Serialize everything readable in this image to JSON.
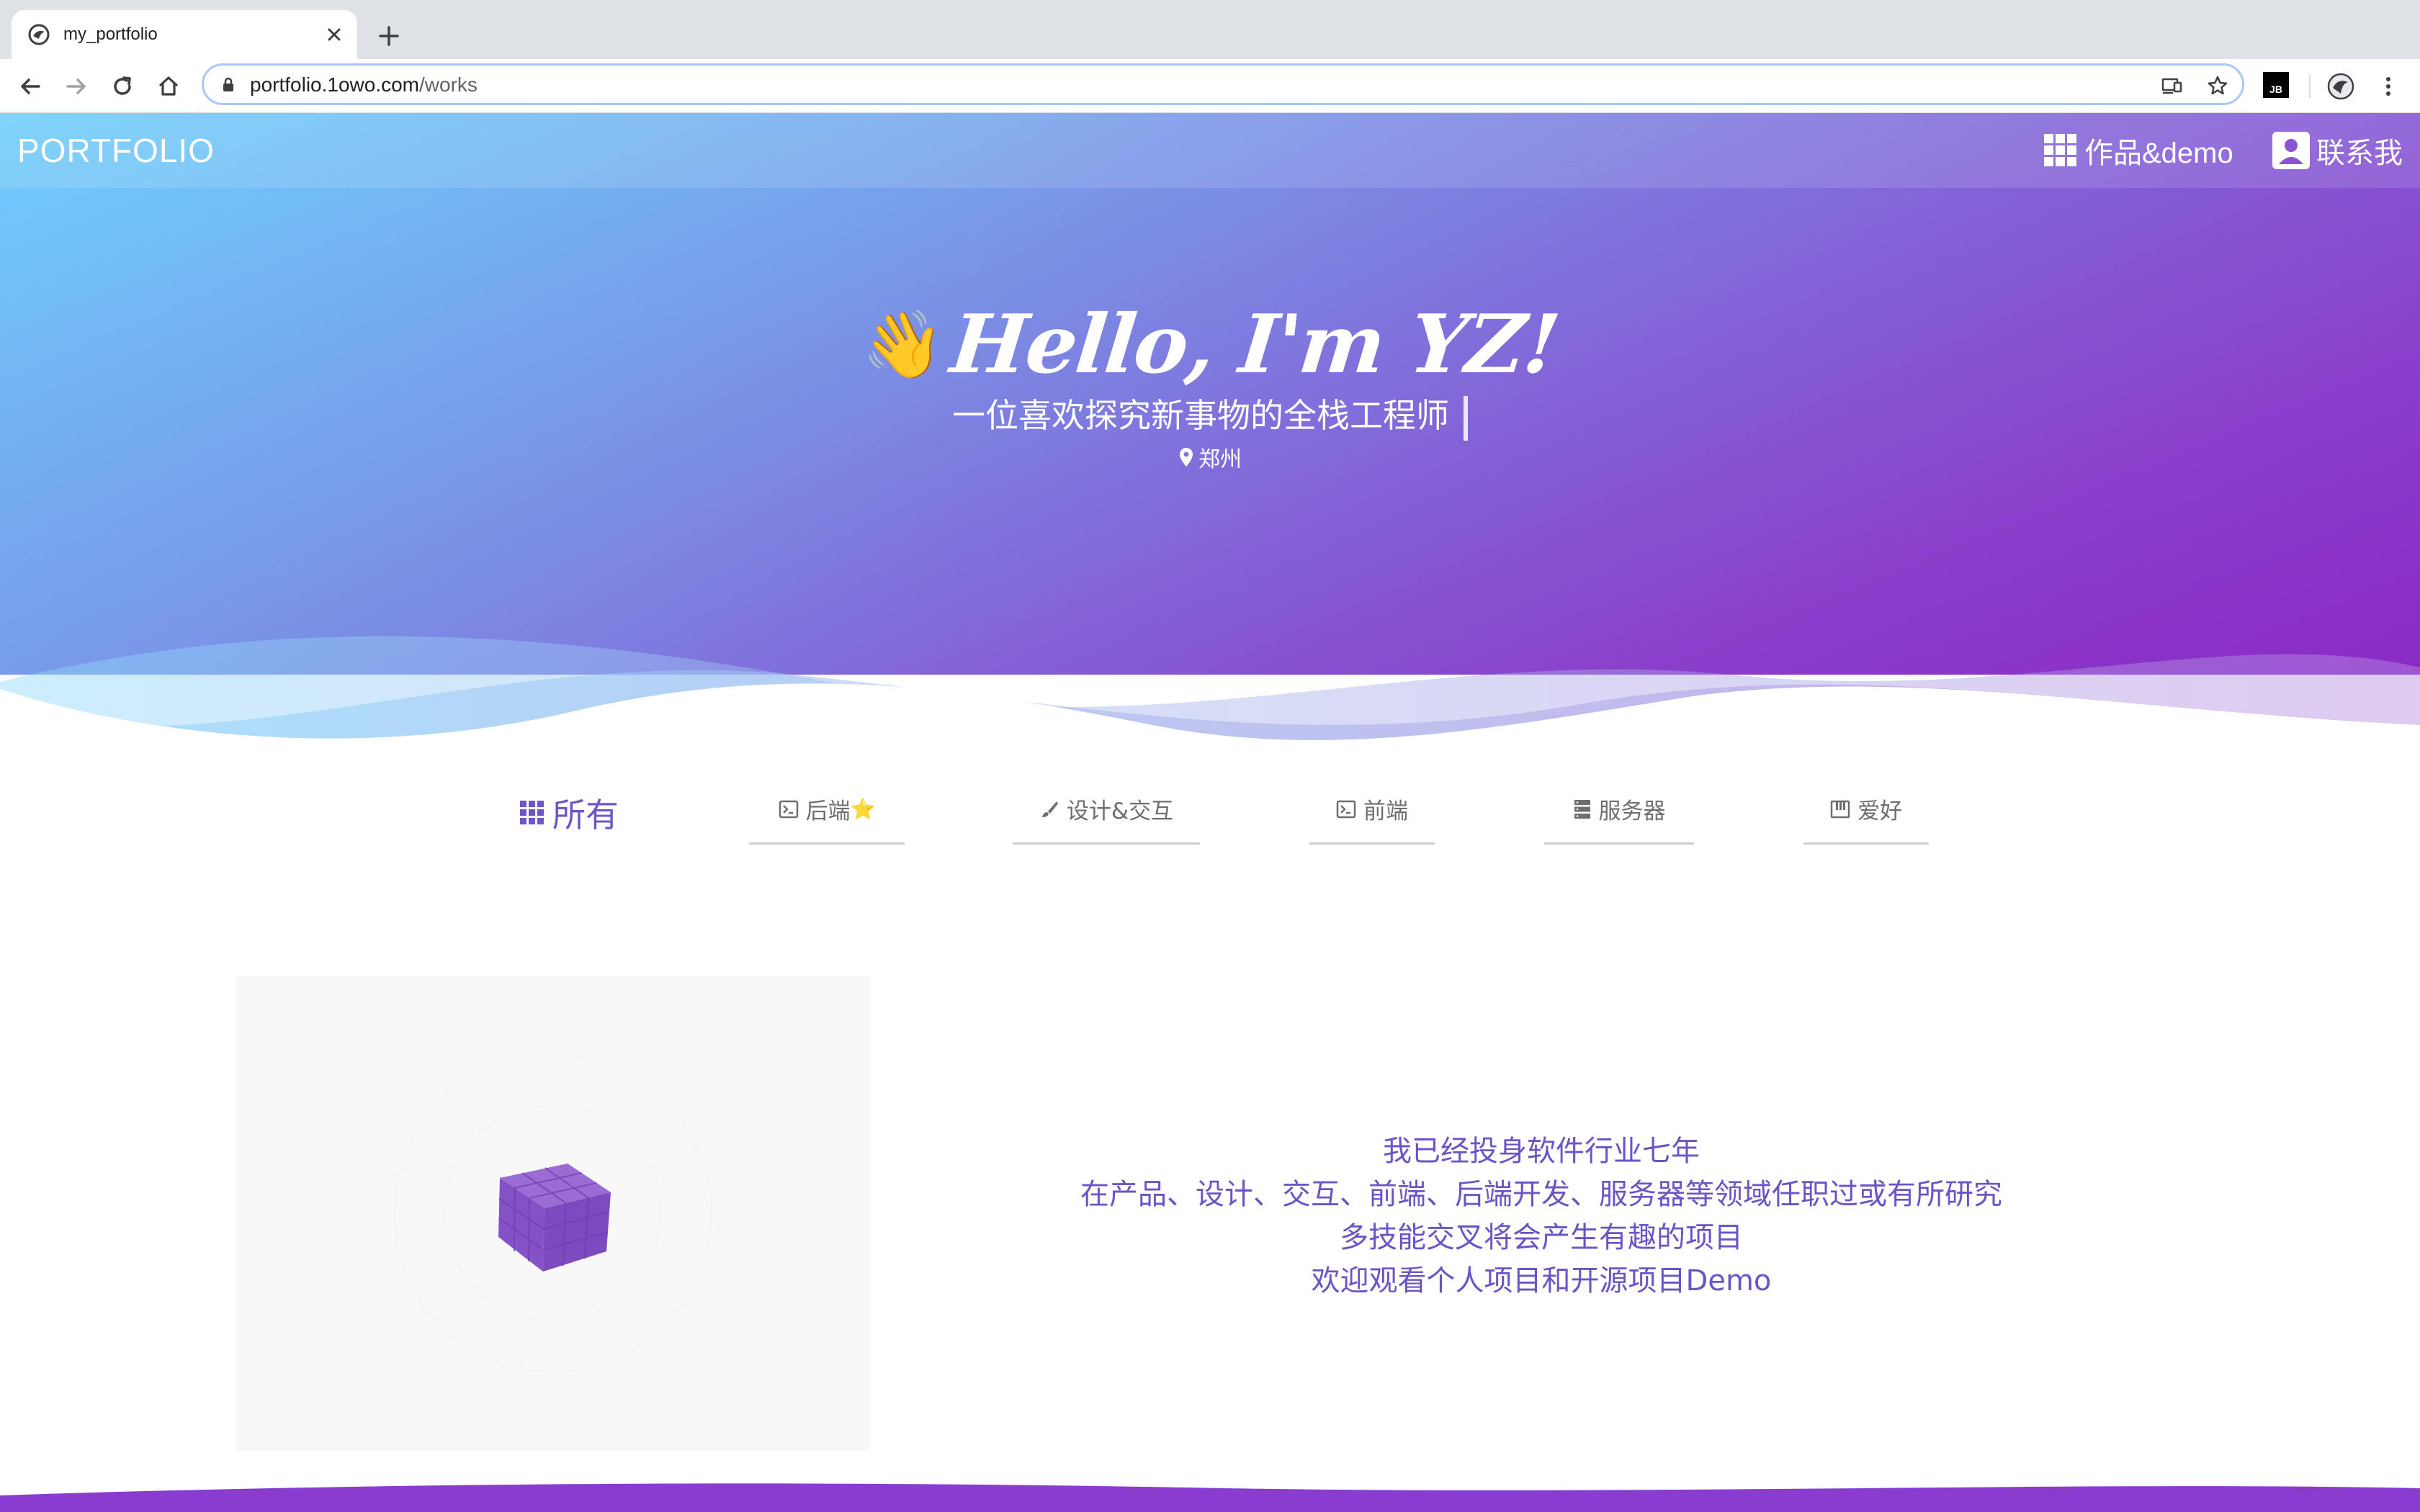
{
  "browser": {
    "tab_title": "my_portfolio",
    "url_host": "portfolio.1owo.com",
    "url_path": "/works",
    "extension_label": "JB"
  },
  "nav": {
    "brand": "PORTFOLIO",
    "works": "作品&demo",
    "contact": "联系我"
  },
  "hero": {
    "emoji": "👋",
    "greeting": "Hello, I'm YZ!",
    "subtitle": "一位喜欢探究新事物的全栈工程师",
    "location": "郑州"
  },
  "filters": [
    {
      "label": "所有",
      "icon": "grid-icon",
      "active": true
    },
    {
      "label": "后端",
      "emoji": "⭐",
      "icon": "terminal-icon"
    },
    {
      "label": "设计&交互",
      "icon": "brush-icon"
    },
    {
      "label": "前端",
      "icon": "terminal-icon"
    },
    {
      "label": "服务器",
      "icon": "server-icon"
    },
    {
      "label": "爱好",
      "icon": "piano-icon"
    }
  ],
  "intro": {
    "lines": [
      "我已经投身软件行业七年",
      "在产品、设计、交互、前端、后端开发、服务器等领域任职过或有所研究",
      "多技能交叉将会产生有趣的项目",
      "欢迎观看个人项目和开源项目Demo"
    ]
  },
  "colors": {
    "hero_start": "#6fd0fb",
    "hero_end": "#8a2bc4",
    "accent": "#6f55c8",
    "cube": "#8a55c8"
  }
}
